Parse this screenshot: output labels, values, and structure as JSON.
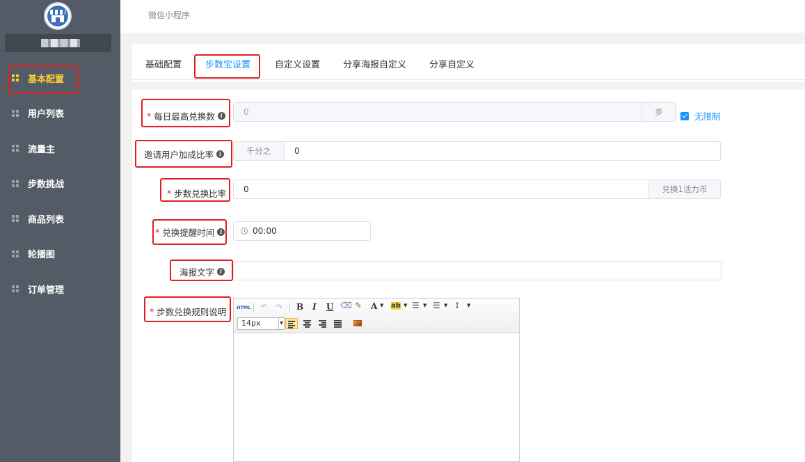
{
  "topbar": {
    "title": "微信小程序"
  },
  "sidebar": {
    "items": [
      {
        "label": "基本配置",
        "active": true
      },
      {
        "label": "用户列表"
      },
      {
        "label": "流量主"
      },
      {
        "label": "步数挑战"
      },
      {
        "label": "商品列表"
      },
      {
        "label": "轮播图"
      },
      {
        "label": "订单管理"
      }
    ]
  },
  "tabs": [
    {
      "label": "基础配置"
    },
    {
      "label": "步数宝设置",
      "active": true
    },
    {
      "label": "自定义设置"
    },
    {
      "label": "分享海报自定义"
    },
    {
      "label": "分享自定义"
    }
  ],
  "form": {
    "daily_max": {
      "label": "每日最高兑换数",
      "required": true,
      "value": "0",
      "suffix": "步",
      "unlimited_label": "无限制",
      "unlimited_checked": true
    },
    "invite_rate": {
      "label": "邀请用户加成比率",
      "prefix": "千分之",
      "value": "0"
    },
    "step_rate": {
      "label": "步数兑换比率",
      "required": true,
      "value": "0",
      "suffix": "兑换1活力币"
    },
    "remind_time": {
      "label": "兑换提醒时间",
      "required": true,
      "value": "00:00"
    },
    "poster_text": {
      "label": "海报文字",
      "value": ""
    },
    "rules": {
      "label": "步数兑换规则说明",
      "required": true
    }
  },
  "editor": {
    "html_label": "HTML",
    "font_size": "14px",
    "bold": "B",
    "italic": "I",
    "underline": "U",
    "font_color": "A",
    "highlight": "ab"
  },
  "colors": {
    "accent": "#1890ff",
    "annotation": "#e02020",
    "sidebar_bg": "#535c66",
    "active_nav": "#ffcc33"
  }
}
